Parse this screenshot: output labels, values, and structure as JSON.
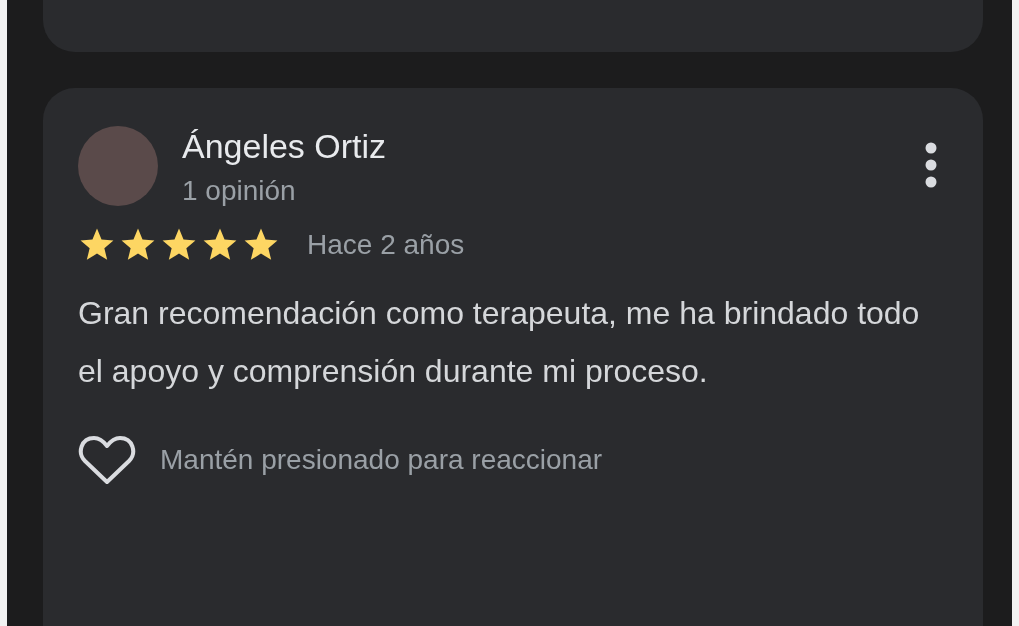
{
  "review": {
    "author": "Ángeles Ortiz",
    "meta": "1 opinión",
    "stars": 5,
    "time": "Hace 2 años",
    "text": "Gran recomendación como terapeuta, me ha brindado todo el apoyo y comprensión durante mi proceso.",
    "reaction_hint": "Mantén presionado para reaccionar"
  }
}
